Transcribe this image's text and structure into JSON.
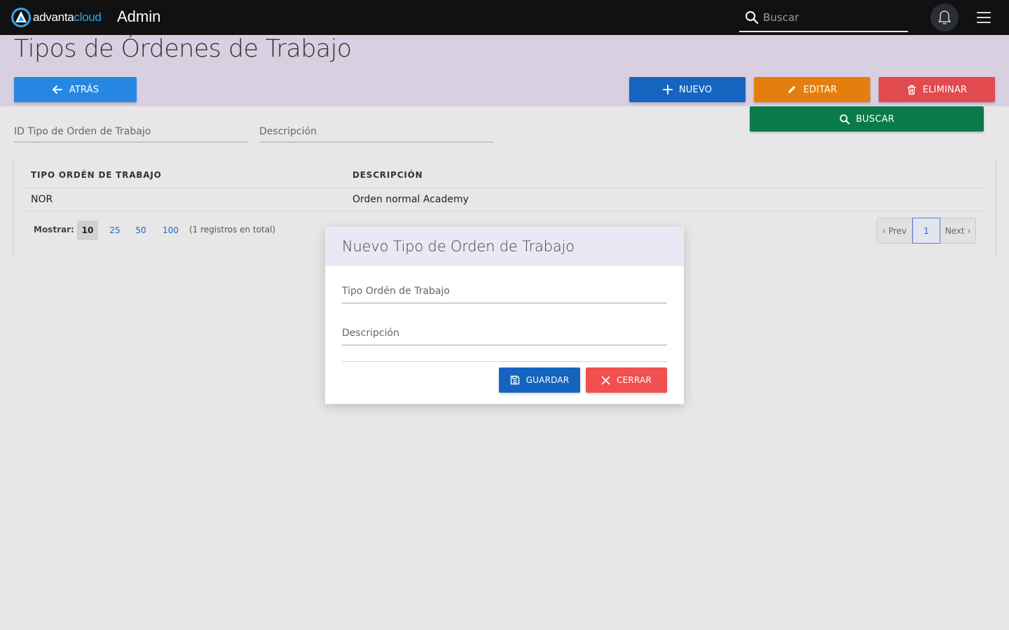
{
  "topbar": {
    "logo_part1": "advanta",
    "logo_part2": "cloud",
    "app_title": "Admin",
    "search_placeholder": "Buscar"
  },
  "page": {
    "title": "Tipos de Órdenes de Trabajo"
  },
  "toolbar": {
    "back_label": "ATRÁS",
    "new_label": "NUEVO",
    "edit_label": "EDITAR",
    "delete_label": "ELIMINAR",
    "search_label": "BUSCAR"
  },
  "filters": {
    "id_label": "ID Tipo de Orden de Trabajo",
    "desc_label": "Descripción"
  },
  "table": {
    "columns": [
      "TIPO ORDÉN DE TRABAJO",
      "DESCRIPCIÓN"
    ],
    "rows": [
      [
        "NOR",
        "Orden normal Academy"
      ]
    ]
  },
  "pagination": {
    "show_label": "Mostrar:",
    "sizes": [
      "10",
      "25",
      "50",
      "100"
    ],
    "active_size": "10",
    "total_text": "(1 registros en total)",
    "prev_label": "‹ Prev",
    "current_page": "1",
    "next_label": "Next ›"
  },
  "modal": {
    "title": "Nuevo Tipo de Orden de Trabajo",
    "field1_label": "Tipo Ordén de Trabajo",
    "field2_label": "Descripción",
    "save_label": "GUARDAR",
    "close_label": "CERRAR"
  },
  "colors": {
    "topbar_bg": "#111111",
    "header_band": "#d8cfe0",
    "back_btn": "#2687e3",
    "new_btn": "#1565c0",
    "edit_btn": "#e47f0e",
    "delete_btn": "#e14a4f",
    "search_btn": "#0a7a4a",
    "close_btn": "#f05050"
  },
  "icons": {
    "back": "arrow-left-icon",
    "new": "plus-icon",
    "edit": "pencil-icon",
    "delete": "trash-icon",
    "search": "search-icon",
    "notifications": "bell-icon",
    "menu": "hamburger-menu-icon",
    "save": "floppy-disk-icon",
    "close": "close-icon"
  }
}
